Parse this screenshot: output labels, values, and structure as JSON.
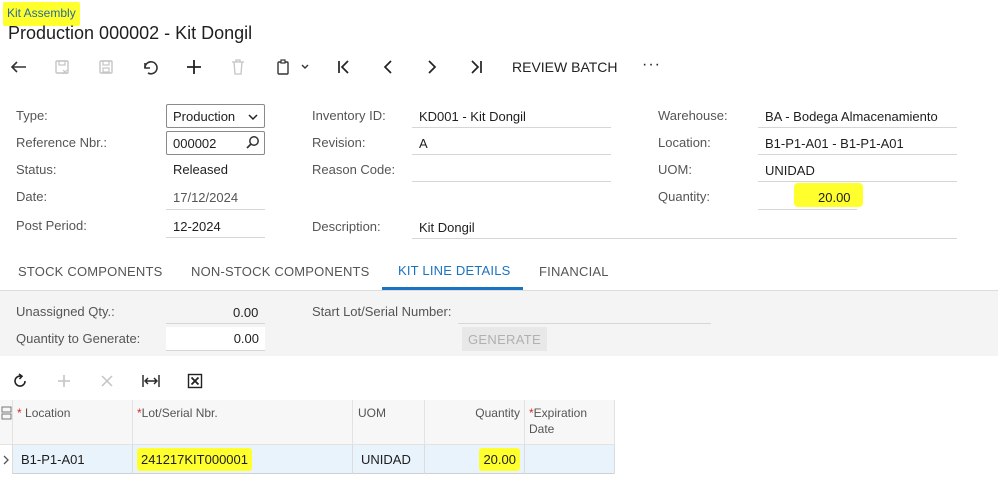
{
  "breadcrumb": "Kit Assembly",
  "page_title": "Production 000002 - Kit Dongil",
  "toolbar": {
    "review_batch": "REVIEW BATCH",
    "more": "···"
  },
  "form": {
    "type_label": "Type:",
    "type_value": "Production",
    "refnbr_label": "Reference Nbr.:",
    "refnbr_value": "000002",
    "status_label": "Status:",
    "status_value": "Released",
    "date_label": "Date:",
    "date_value": "17/12/2024",
    "postperiod_label": "Post Period:",
    "postperiod_value": "12-2024",
    "inventory_label": "Inventory ID:",
    "inventory_value": "KD001 - Kit Dongil",
    "revision_label": "Revision:",
    "revision_value": "A",
    "reason_label": "Reason Code:",
    "reason_value": "",
    "description_label": "Description:",
    "description_value": "Kit Dongil",
    "warehouse_label": "Warehouse:",
    "warehouse_value": "BA - Bodega Almacenamiento",
    "location_label": "Location:",
    "location_value": "B1-P1-A01 - B1-P1-A01",
    "uom_label": "UOM:",
    "uom_value": "UNIDAD",
    "quantity_label": "Quantity:",
    "quantity_value": "20.00"
  },
  "tabs": [
    {
      "label": "STOCK COMPONENTS",
      "active": false
    },
    {
      "label": "NON-STOCK COMPONENTS",
      "active": false
    },
    {
      "label": "KIT LINE DETAILS",
      "active": true
    },
    {
      "label": "FINANCIAL",
      "active": false
    }
  ],
  "lot_panel": {
    "unassigned_label": "Unassigned Qty.:",
    "unassigned_value": "0.00",
    "qty_generate_label": "Quantity to Generate:",
    "qty_generate_value": "0.00",
    "start_lot_label": "Start Lot/Serial Number:",
    "start_lot_value": "",
    "generate_button": "GENERATE"
  },
  "grid": {
    "columns": [
      {
        "label": "Location",
        "required": true
      },
      {
        "label": "Lot/Serial Nbr.",
        "required": true
      },
      {
        "label": "UOM",
        "required": false
      },
      {
        "label": "Quantity",
        "required": false
      },
      {
        "label": "Expiration Date",
        "required": true
      }
    ],
    "rows": [
      {
        "location": "B1-P1-A01",
        "lot_serial": "241217KIT000001",
        "uom": "UNIDAD",
        "quantity": "20.00",
        "expiration": ""
      }
    ]
  },
  "colors": {
    "highlight": "#ffff2e",
    "accent": "#1a73c0",
    "required": "#d62b2b"
  },
  "icons": [
    "back-icon",
    "save-close-icon",
    "save-icon",
    "undo-icon",
    "add-icon",
    "delete-icon",
    "copy-paste-icon",
    "first-record-icon",
    "previous-record-icon",
    "next-record-icon",
    "last-record-icon",
    "refresh-icon",
    "fit-columns-icon",
    "export-excel-icon"
  ]
}
